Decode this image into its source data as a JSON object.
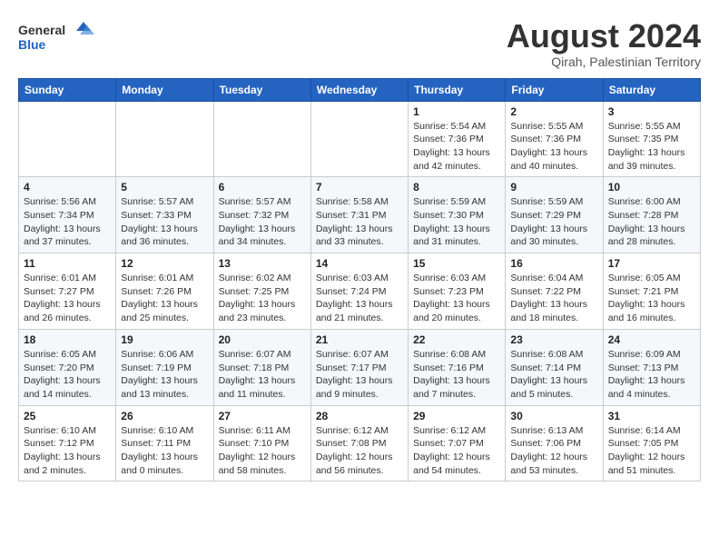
{
  "logo": {
    "line1": "General",
    "line2": "Blue"
  },
  "title": {
    "month_year": "August 2024",
    "location": "Qirah, Palestinian Territory"
  },
  "days_of_week": [
    "Sunday",
    "Monday",
    "Tuesday",
    "Wednesday",
    "Thursday",
    "Friday",
    "Saturday"
  ],
  "weeks": [
    [
      {
        "day": "",
        "info": ""
      },
      {
        "day": "",
        "info": ""
      },
      {
        "day": "",
        "info": ""
      },
      {
        "day": "",
        "info": ""
      },
      {
        "day": "1",
        "info": "Sunrise: 5:54 AM\nSunset: 7:36 PM\nDaylight: 13 hours\nand 42 minutes."
      },
      {
        "day": "2",
        "info": "Sunrise: 5:55 AM\nSunset: 7:36 PM\nDaylight: 13 hours\nand 40 minutes."
      },
      {
        "day": "3",
        "info": "Sunrise: 5:55 AM\nSunset: 7:35 PM\nDaylight: 13 hours\nand 39 minutes."
      }
    ],
    [
      {
        "day": "4",
        "info": "Sunrise: 5:56 AM\nSunset: 7:34 PM\nDaylight: 13 hours\nand 37 minutes."
      },
      {
        "day": "5",
        "info": "Sunrise: 5:57 AM\nSunset: 7:33 PM\nDaylight: 13 hours\nand 36 minutes."
      },
      {
        "day": "6",
        "info": "Sunrise: 5:57 AM\nSunset: 7:32 PM\nDaylight: 13 hours\nand 34 minutes."
      },
      {
        "day": "7",
        "info": "Sunrise: 5:58 AM\nSunset: 7:31 PM\nDaylight: 13 hours\nand 33 minutes."
      },
      {
        "day": "8",
        "info": "Sunrise: 5:59 AM\nSunset: 7:30 PM\nDaylight: 13 hours\nand 31 minutes."
      },
      {
        "day": "9",
        "info": "Sunrise: 5:59 AM\nSunset: 7:29 PM\nDaylight: 13 hours\nand 30 minutes."
      },
      {
        "day": "10",
        "info": "Sunrise: 6:00 AM\nSunset: 7:28 PM\nDaylight: 13 hours\nand 28 minutes."
      }
    ],
    [
      {
        "day": "11",
        "info": "Sunrise: 6:01 AM\nSunset: 7:27 PM\nDaylight: 13 hours\nand 26 minutes."
      },
      {
        "day": "12",
        "info": "Sunrise: 6:01 AM\nSunset: 7:26 PM\nDaylight: 13 hours\nand 25 minutes."
      },
      {
        "day": "13",
        "info": "Sunrise: 6:02 AM\nSunset: 7:25 PM\nDaylight: 13 hours\nand 23 minutes."
      },
      {
        "day": "14",
        "info": "Sunrise: 6:03 AM\nSunset: 7:24 PM\nDaylight: 13 hours\nand 21 minutes."
      },
      {
        "day": "15",
        "info": "Sunrise: 6:03 AM\nSunset: 7:23 PM\nDaylight: 13 hours\nand 20 minutes."
      },
      {
        "day": "16",
        "info": "Sunrise: 6:04 AM\nSunset: 7:22 PM\nDaylight: 13 hours\nand 18 minutes."
      },
      {
        "day": "17",
        "info": "Sunrise: 6:05 AM\nSunset: 7:21 PM\nDaylight: 13 hours\nand 16 minutes."
      }
    ],
    [
      {
        "day": "18",
        "info": "Sunrise: 6:05 AM\nSunset: 7:20 PM\nDaylight: 13 hours\nand 14 minutes."
      },
      {
        "day": "19",
        "info": "Sunrise: 6:06 AM\nSunset: 7:19 PM\nDaylight: 13 hours\nand 13 minutes."
      },
      {
        "day": "20",
        "info": "Sunrise: 6:07 AM\nSunset: 7:18 PM\nDaylight: 13 hours\nand 11 minutes."
      },
      {
        "day": "21",
        "info": "Sunrise: 6:07 AM\nSunset: 7:17 PM\nDaylight: 13 hours\nand 9 minutes."
      },
      {
        "day": "22",
        "info": "Sunrise: 6:08 AM\nSunset: 7:16 PM\nDaylight: 13 hours\nand 7 minutes."
      },
      {
        "day": "23",
        "info": "Sunrise: 6:08 AM\nSunset: 7:14 PM\nDaylight: 13 hours\nand 5 minutes."
      },
      {
        "day": "24",
        "info": "Sunrise: 6:09 AM\nSunset: 7:13 PM\nDaylight: 13 hours\nand 4 minutes."
      }
    ],
    [
      {
        "day": "25",
        "info": "Sunrise: 6:10 AM\nSunset: 7:12 PM\nDaylight: 13 hours\nand 2 minutes."
      },
      {
        "day": "26",
        "info": "Sunrise: 6:10 AM\nSunset: 7:11 PM\nDaylight: 13 hours\nand 0 minutes."
      },
      {
        "day": "27",
        "info": "Sunrise: 6:11 AM\nSunset: 7:10 PM\nDaylight: 12 hours\nand 58 minutes."
      },
      {
        "day": "28",
        "info": "Sunrise: 6:12 AM\nSunset: 7:08 PM\nDaylight: 12 hours\nand 56 minutes."
      },
      {
        "day": "29",
        "info": "Sunrise: 6:12 AM\nSunset: 7:07 PM\nDaylight: 12 hours\nand 54 minutes."
      },
      {
        "day": "30",
        "info": "Sunrise: 6:13 AM\nSunset: 7:06 PM\nDaylight: 12 hours\nand 53 minutes."
      },
      {
        "day": "31",
        "info": "Sunrise: 6:14 AM\nSunset: 7:05 PM\nDaylight: 12 hours\nand 51 minutes."
      }
    ]
  ]
}
